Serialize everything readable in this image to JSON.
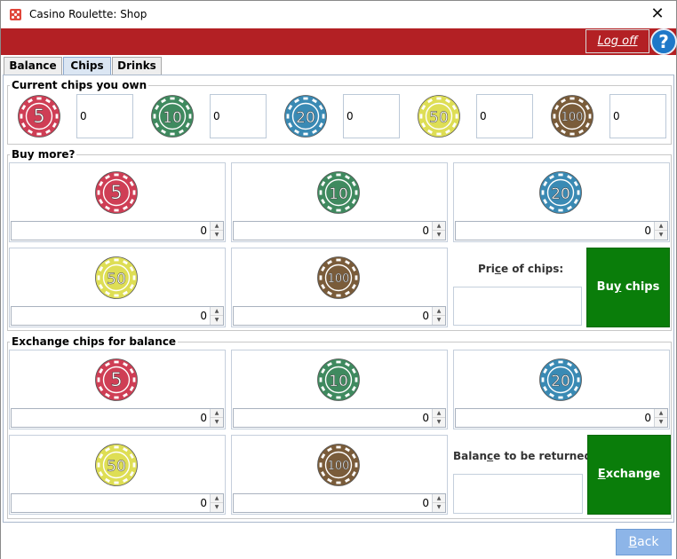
{
  "window": {
    "title": "Casino Roulette: Shop"
  },
  "header": {
    "logoff_label": "Log off",
    "help_label": "?"
  },
  "tabs": [
    {
      "label": "Balance"
    },
    {
      "label": "Chips"
    },
    {
      "label": "Drinks"
    }
  ],
  "active_tab": "Chips",
  "chip_colors": {
    "5": "#cf3e55",
    "10": "#3f8a5f",
    "20": "#3a8ab4",
    "50": "#dede55",
    "100": "#7a5c3a"
  },
  "owned": {
    "legend": "Current chips you own",
    "chips": [
      {
        "denomination": "5",
        "value": "0"
      },
      {
        "denomination": "10",
        "value": "0"
      },
      {
        "denomination": "20",
        "value": "0"
      },
      {
        "denomination": "50",
        "value": "0"
      },
      {
        "denomination": "100",
        "value": "0"
      }
    ]
  },
  "buy": {
    "legend": "Buy more?",
    "chips": [
      {
        "denomination": "5",
        "value": "0"
      },
      {
        "denomination": "10",
        "value": "0"
      },
      {
        "denomination": "20",
        "value": "0"
      },
      {
        "denomination": "50",
        "value": "0"
      },
      {
        "denomination": "100",
        "value": "0"
      }
    ],
    "price_label_pre": "Pri",
    "price_label_mnemonic": "c",
    "price_label_post": "e of chips:",
    "price_value": "",
    "button_pre": "Bu",
    "button_mnemonic": "y",
    "button_post": " chips"
  },
  "exchange": {
    "legend": "Exchange chips for balance",
    "chips": [
      {
        "denomination": "5",
        "value": "0"
      },
      {
        "denomination": "10",
        "value": "0"
      },
      {
        "denomination": "20",
        "value": "0"
      },
      {
        "denomination": "50",
        "value": "0"
      },
      {
        "denomination": "100",
        "value": "0"
      }
    ],
    "balance_label_pre": "Balan",
    "balance_label_mnemonic": "c",
    "balance_label_post": "e to be returned:",
    "balance_value": "",
    "button_mnemonic": "E",
    "button_post": "xchange"
  },
  "footer": {
    "back_mnemonic": "B",
    "back_post": "ack"
  }
}
